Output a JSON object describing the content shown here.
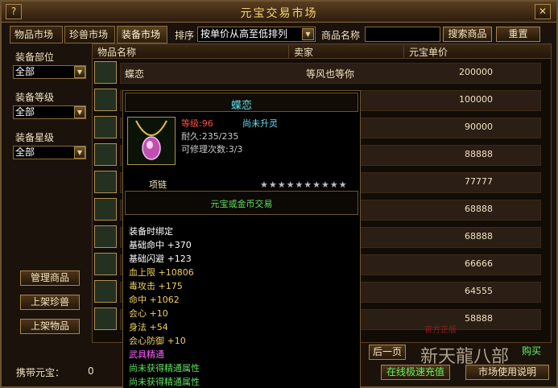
{
  "window": {
    "title": "元宝交易市场",
    "help_label": "?",
    "close_label": "✕"
  },
  "tabs": [
    {
      "label": "物品市场"
    },
    {
      "label": "珍兽市场"
    },
    {
      "label": "装备市场",
      "active": true
    }
  ],
  "toolbar": {
    "sort_label": "排序",
    "sort_value": "按单价从高至低排列",
    "name_label": "商品名称",
    "name_value": "",
    "search_label": "搜索商品",
    "reset_label": "重置"
  },
  "filters": [
    {
      "label": "装备部位",
      "value": "全部"
    },
    {
      "label": "装备等级",
      "value": "全部"
    },
    {
      "label": "装备星级",
      "value": "全部"
    }
  ],
  "side_buttons": [
    "管理商品",
    "上架珍兽",
    "上架物品"
  ],
  "table": {
    "headers": [
      "物品名称",
      "卖家",
      "元宝单价"
    ],
    "rows": [
      {
        "name": "蝶恋",
        "seller": "等风也等你",
        "price": "200000",
        "icon": "necklace-icon"
      },
      {
        "name": "",
        "seller": "",
        "price": "100000",
        "icon": "necklace-icon"
      },
      {
        "name": "",
        "seller": "",
        "price": "90000",
        "icon": "bracer-icon"
      },
      {
        "name": "",
        "seller": "",
        "price": "88888",
        "icon": "ring-icon"
      },
      {
        "name": "",
        "seller": "",
        "price": "77777",
        "icon": "ring-icon"
      },
      {
        "name": "",
        "seller": "",
        "price": "68888",
        "icon": "armor-icon"
      },
      {
        "name": "",
        "seller": "",
        "price": "68888",
        "icon": "necklace-icon"
      },
      {
        "name": "",
        "seller": "",
        "price": "66666",
        "icon": "armor-icon"
      },
      {
        "name": "",
        "seller": "",
        "price": "64555",
        "icon": "pet-icon"
      },
      {
        "name": "",
        "seller": "",
        "price": "58888",
        "icon": "bracer-icon"
      }
    ]
  },
  "tooltip": {
    "title": "蝶恋",
    "level": "等级:96",
    "spirit": "尚未升灵",
    "durability": "耐久:235/235",
    "repair": "可修理次数:3/3",
    "type": "项链",
    "stars": "★★★★★★★★★★",
    "trade": "元宝或金币交易",
    "bind": "装备时绑定",
    "attrs": [
      {
        "label": "基础命中 +370",
        "color": "#ffffff"
      },
      {
        "label": "基础闪避 +123",
        "color": "#ffffff"
      },
      {
        "label": "血上限 +10806",
        "color": "#f0d060"
      },
      {
        "label": "毒攻击 +175",
        "color": "#f0d060"
      },
      {
        "label": "命中 +1062",
        "color": "#f0d060"
      },
      {
        "label": "会心 +10",
        "color": "#f0d060"
      },
      {
        "label": "身法 +54",
        "color": "#f0d060"
      },
      {
        "label": "会心防御 +10",
        "color": "#f0d060"
      },
      {
        "label": "武具精通",
        "color": "#ff60ff"
      },
      {
        "label": "尚未获得精通属性",
        "color": "#60e060"
      },
      {
        "label": "尚未获得精通属性",
        "color": "#60e060"
      }
    ]
  },
  "footer": {
    "currency_label": "携带元宝：",
    "currency_value": "0",
    "prev_page": "后一页",
    "buy": "购买",
    "recharge": "在线极速充值",
    "help": "市场使用说明"
  },
  "watermark": {
    "small": "官方正版",
    "big": "新天龍八部"
  },
  "colors": {
    "accent": "#f6d470",
    "tooltip_title": "#5ee2f2",
    "level_red": "#ff5040",
    "green": "#62f262"
  }
}
